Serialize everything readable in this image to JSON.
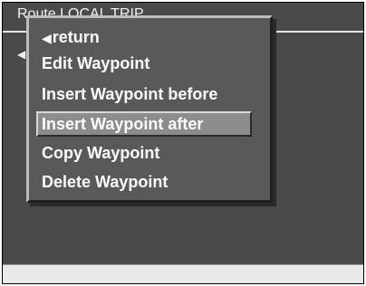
{
  "header": {
    "title": "Route LOCAL TRIP"
  },
  "menu": {
    "items": [
      {
        "label": "return",
        "icon": "back-arrow-icon",
        "selected": false
      },
      {
        "label": "Edit Waypoint",
        "selected": false
      },
      {
        "label": "Insert Waypoint before",
        "selected": false
      },
      {
        "label": "Insert Waypoint after",
        "selected": true
      },
      {
        "label": "Copy Waypoint",
        "selected": false
      },
      {
        "label": "Delete Waypoint",
        "selected": false
      }
    ]
  },
  "colors": {
    "background": "#4a4a4a",
    "menu": "#595959",
    "selected": "#8c8c8c",
    "text": "#ffffff"
  }
}
